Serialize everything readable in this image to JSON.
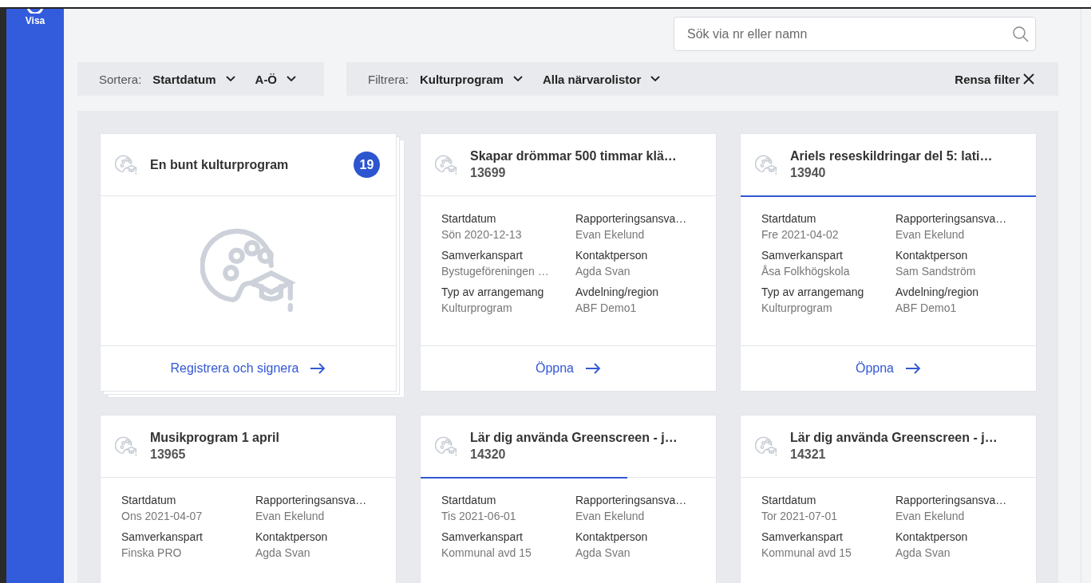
{
  "sidebar": {
    "items": [
      {
        "label": "Visa"
      }
    ]
  },
  "search": {
    "placeholder": "Sök via nr eller namn"
  },
  "sort": {
    "label": "Sortera:",
    "options": [
      "Startdatum",
      "A-Ö"
    ]
  },
  "filter": {
    "label": "Filtrera:",
    "options": [
      "Kulturprogram",
      "Alla närvarolistor"
    ],
    "clear": "Rensa filter"
  },
  "cards": [
    {
      "kind": "bundle",
      "title": "En bunt kulturprogram",
      "count": "19",
      "action": "Registrera och signera"
    },
    {
      "kind": "event",
      "title": "Skapar drömmar 500 timmar klä…",
      "number": "13699",
      "fields": [
        {
          "label": "Startdatum",
          "value": "Sön 2020-12-13"
        },
        {
          "label": "Rapporteringsansva…",
          "value": "Evan Ekelund"
        },
        {
          "label": "Samverkanspart",
          "value": "Bystugeföreningen …"
        },
        {
          "label": "Kontaktperson",
          "value": "Agda Svan"
        },
        {
          "label": "Typ av arrangemang",
          "value": "Kulturprogram"
        },
        {
          "label": "Avdelning/region",
          "value": "ABF Demo1"
        }
      ],
      "action": "Öppna"
    },
    {
      "kind": "event",
      "title": "Ariels reseskildringar del 5: lati…",
      "number": "13940",
      "level": 1,
      "fields": [
        {
          "label": "Startdatum",
          "value": "Fre 2021-04-02"
        },
        {
          "label": "Rapporteringsansva…",
          "value": "Evan Ekelund"
        },
        {
          "label": "Samverkanspart",
          "value": "Åsa Folkhögskola"
        },
        {
          "label": "Kontaktperson",
          "value": "Sam Sandström"
        },
        {
          "label": "Typ av arrangemang",
          "value": "Kulturprogram"
        },
        {
          "label": "Avdelning/region",
          "value": "ABF Demo1"
        }
      ],
      "action": "Öppna"
    },
    {
      "kind": "event",
      "title": "Musikprogram 1 april",
      "number": "13965",
      "fields": [
        {
          "label": "Startdatum",
          "value": "Ons 2021-04-07"
        },
        {
          "label": "Rapporteringsansva…",
          "value": "Evan Ekelund"
        },
        {
          "label": "Samverkanspart",
          "value": "Finska PRO"
        },
        {
          "label": "Kontaktperson",
          "value": "Agda Svan"
        }
      ]
    },
    {
      "kind": "event",
      "title": "Lär dig använda Greenscreen - j…",
      "number": "14320",
      "level": 0.7,
      "fields": [
        {
          "label": "Startdatum",
          "value": "Tis 2021-06-01"
        },
        {
          "label": "Rapporteringsansva…",
          "value": "Evan Ekelund"
        },
        {
          "label": "Samverkanspart",
          "value": "Kommunal avd 15"
        },
        {
          "label": "Kontaktperson",
          "value": "Agda Svan"
        }
      ]
    },
    {
      "kind": "event",
      "title": "Lär dig använda Greenscreen - j…",
      "number": "14321",
      "fields": [
        {
          "label": "Startdatum",
          "value": "Tor 2021-07-01"
        },
        {
          "label": "Rapporteringsansva…",
          "value": "Evan Ekelund"
        },
        {
          "label": "Samverkanspart",
          "value": "Kommunal avd 15"
        },
        {
          "label": "Kontaktperson",
          "value": "Agda Svan"
        }
      ]
    }
  ]
}
